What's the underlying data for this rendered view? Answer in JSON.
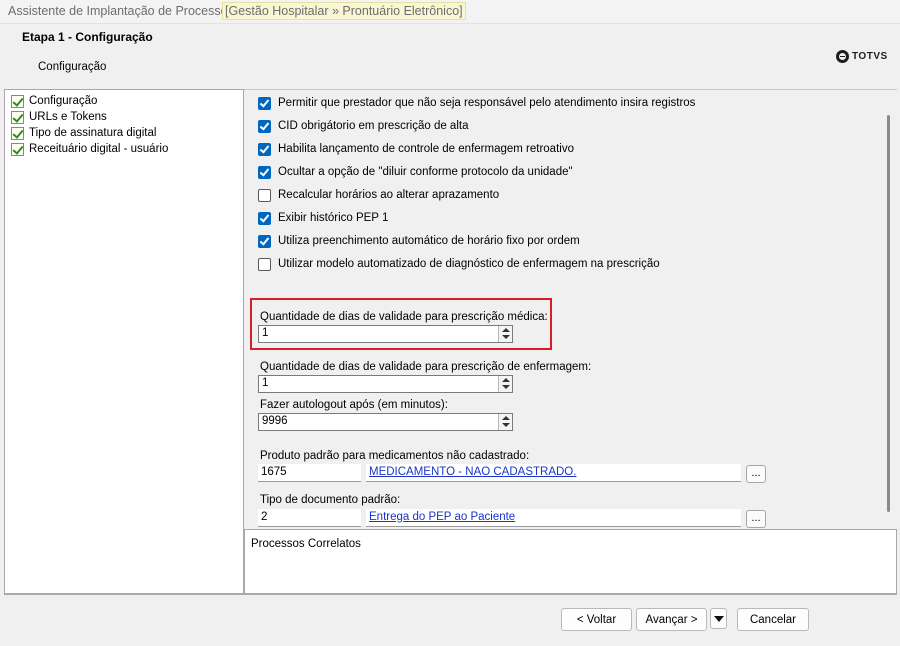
{
  "window": {
    "title": "Assistente de Implantação de Processos",
    "context": "[Gestão Hospitalar » Prontuário Eletrônico]"
  },
  "header": {
    "step_title": "Etapa 1 - Configuração",
    "subtitle": "Configuração",
    "logo_text": "TOTVS"
  },
  "sidebar": {
    "items": [
      {
        "label": "Configuração",
        "icon": "check-document-icon"
      },
      {
        "label": "URLs e Tokens",
        "icon": "check-document-icon"
      },
      {
        "label": "Tipo de assinatura digital",
        "icon": "check-document-icon"
      },
      {
        "label": "Receituário digital - usuário",
        "icon": "check-document-icon"
      }
    ]
  },
  "options": [
    {
      "label": "Permitir que prestador que não seja responsável pelo atendimento insira registros",
      "checked": true
    },
    {
      "label": "CID obrigátorio em prescrição de alta",
      "checked": true
    },
    {
      "label": "Habilita lançamento de controle de enfermagem retroativo",
      "checked": true
    },
    {
      "label": "Ocultar a opção de \"diluir conforme protocolo da unidade\"",
      "checked": true
    },
    {
      "label": "Recalcular horários ao alterar aprazamento",
      "checked": false
    },
    {
      "label": "Exibir histórico PEP 1",
      "checked": true
    },
    {
      "label": "Utiliza preenchimento automático de horário fixo por ordem",
      "checked": true
    },
    {
      "label": "Utilizar modelo automatizado de diagnóstico de enfermagem na prescrição",
      "checked": false
    }
  ],
  "fields": {
    "validade_medica": {
      "label": "Quantidade de dias de validade para prescrição médica:",
      "value": "1"
    },
    "validade_enfermagem": {
      "label": "Quantidade de dias de validade para prescrição de enfermagem:",
      "value": "1"
    },
    "autologout": {
      "label": "Fazer autologout após (em minutos):",
      "value": "9996"
    },
    "produto_padrao": {
      "label": "Produto padrão para medicamentos não cadastrado:",
      "code": "1675",
      "description": "MEDICAMENTO - NAO CADASTRADO.",
      "lookup": "..."
    },
    "tipo_documento": {
      "label": "Tipo de documento padrão:",
      "code": "2",
      "description": "Entrega do PEP ao Paciente",
      "lookup": "..."
    }
  },
  "related": {
    "label": "Processos Correlatos"
  },
  "buttons": {
    "back": "< Voltar",
    "next": "Avançar >",
    "cancel": "Cancelar"
  },
  "colors": {
    "checkbox_checked": "#0067c0",
    "highlight_border": "#d62028",
    "link": "#1a35c8"
  }
}
